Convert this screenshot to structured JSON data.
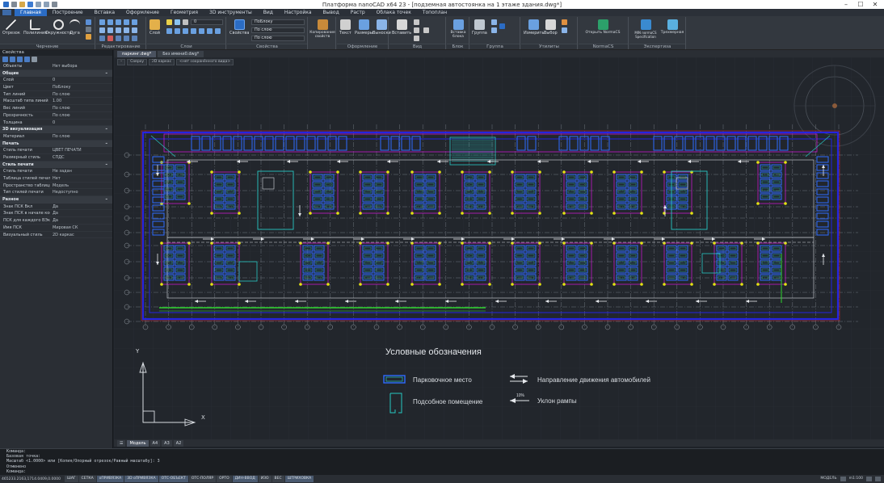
{
  "titlebar": {
    "title": "Платформа nanoCAD x64 23 - [подземная автостоянка на 1 этаже здания.dwg*]"
  },
  "ribbon_tabs": [
    "Главная",
    "Построение",
    "Вставка",
    "Оформление",
    "Геометрия",
    "3D инструменты",
    "Вид",
    "Настройка",
    "Вывод",
    "Растр",
    "Облака точек",
    "Топоплан"
  ],
  "ribbon_groups": [
    {
      "label": "Черчение",
      "buttons": [
        "Отрезок",
        "Полилиния",
        "Окружность",
        "Дуга"
      ]
    },
    {
      "label": "Редактирование",
      "buttons": []
    },
    {
      "label": "Слои",
      "buttons": [
        "Слой"
      ]
    },
    {
      "label": "Свойства",
      "buttons": [
        "Свойства"
      ],
      "dropdowns": [
        "ПоБлоку",
        "По слою",
        "По слою"
      ]
    },
    {
      "label": "Копирование свойств",
      "buttons": [
        "Копирование свойств"
      ]
    },
    {
      "label": "Оформление",
      "buttons": [
        "Текст",
        "Размеры",
        "Выноски"
      ]
    },
    {
      "label": "Вид",
      "buttons": [
        "Вставить"
      ]
    },
    {
      "label": "Блок",
      "buttons": [
        "Вставка блока"
      ]
    },
    {
      "label": "Группа",
      "buttons": [
        "Группа"
      ]
    },
    {
      "label": "Утилиты",
      "buttons": [
        "Измерить",
        "Выбор"
      ]
    },
    {
      "label": "NormaCS",
      "buttons": [
        "Открыть NormaCS"
      ]
    },
    {
      "label": "Экспертиза",
      "buttons": [
        "MIN normaCS Specification",
        "Трехмерная"
      ]
    }
  ],
  "properties": {
    "header": "Свойства",
    "selector": "Нет выбора",
    "sections": [
      {
        "title": "Общие",
        "rows": [
          {
            "k": "Слой",
            "v": "0"
          },
          {
            "k": "Цвет",
            "v": "ПоБлоку"
          },
          {
            "k": "Тип линий",
            "v": "По слою"
          },
          {
            "k": "Масштаб типа линий",
            "v": "1.00"
          },
          {
            "k": "Вес линий",
            "v": "По слою"
          },
          {
            "k": "Прозрачность",
            "v": "По слою"
          },
          {
            "k": "Толщина",
            "v": "0"
          }
        ]
      },
      {
        "title": "3D визуализация",
        "rows": [
          {
            "k": "Материал",
            "v": "По слою"
          }
        ]
      },
      {
        "title": "Печать",
        "rows": [
          {
            "k": "Стиль печати",
            "v": "ЦВЕТ ПЕЧАТИ"
          },
          {
            "k": "Размерный стиль",
            "v": "СПДС"
          }
        ]
      },
      {
        "title": "Стиль печати",
        "rows": [
          {
            "k": "Стиль печати",
            "v": "Не задан"
          },
          {
            "k": "Таблица стилей печати",
            "v": "Нет"
          },
          {
            "k": "Пространство таблицы печати",
            "v": "Модель"
          },
          {
            "k": "Тип стилей печати",
            "v": "Недоступно"
          }
        ]
      },
      {
        "title": "Разное",
        "rows": [
          {
            "k": "Знак ПСК Вкл",
            "v": "Да"
          },
          {
            "k": "Знак ПСК в начале коорд.",
            "v": "Да"
          },
          {
            "k": "ПСК для каждого ВЭкрана",
            "v": "Да"
          },
          {
            "k": "Имя ПСК",
            "v": "Мировая СК"
          },
          {
            "k": "Визуальный стиль",
            "v": "2D каркас"
          }
        ]
      }
    ]
  },
  "doc_tabs": [
    "паркинг.dwg*",
    "Без имени0.dwg*"
  ],
  "viewport_controls": [
    "–",
    "Сверху",
    "2D каркас",
    "<нет сохранённого вида>"
  ],
  "legend": {
    "title": "Условные обозначения",
    "items": [
      {
        "label": "Парковочное место",
        "symbol": "parking-space"
      },
      {
        "label": "Подсобное помещение",
        "symbol": "utility-room"
      },
      {
        "label": "Направление движения автомобилей",
        "symbol": "traffic-direction"
      },
      {
        "label": "Уклон рампы",
        "symbol": "ramp-slope"
      }
    ],
    "ramp_percent": "10%"
  },
  "ucs": {
    "x_label": "X",
    "y_label": "Y"
  },
  "layout_tabs": [
    "Модель",
    "А4",
    "А3",
    "А2"
  ],
  "command_lines": [
    "Команда:",
    "Базовая точка:",
    "Масштаб <1.0000> или [Копия/Опорный отрезок/Равный масштабу]: 3",
    "Отменено",
    "Команда:"
  ],
  "statusbar": {
    "coords": "465233.2163,1714.0409,0.0000",
    "buttons": [
      {
        "label": "ШАГ",
        "on": false
      },
      {
        "label": "СЕТКА",
        "on": false
      },
      {
        "label": "оПРИВЯЗКА",
        "on": true
      },
      {
        "label": "3D оПРИВЯЗКА",
        "on": true
      },
      {
        "label": "ОТС-ОБЪЕКТ",
        "on": true
      },
      {
        "label": "ОТС-ПОЛЯР",
        "on": false
      },
      {
        "label": "ОРТО",
        "on": false
      },
      {
        "label": "ДИН-ВВОД",
        "on": true
      },
      {
        "label": "ИЗО",
        "on": false
      },
      {
        "label": "ВЕС",
        "on": false
      },
      {
        "label": "ШТРИХОВКА",
        "on": true
      }
    ],
    "right": {
      "space": "МОДЕЛЬ",
      "scale": "m1:100"
    }
  },
  "colors": {
    "canvas_bg": "#22262c",
    "wall": "#2424e0",
    "parking": "#2e6cff",
    "room": "#27c8c2",
    "column": "#e4e411",
    "magenta": "#c21ac8",
    "green": "#2fd62f",
    "accent": "#2b6cc4"
  }
}
